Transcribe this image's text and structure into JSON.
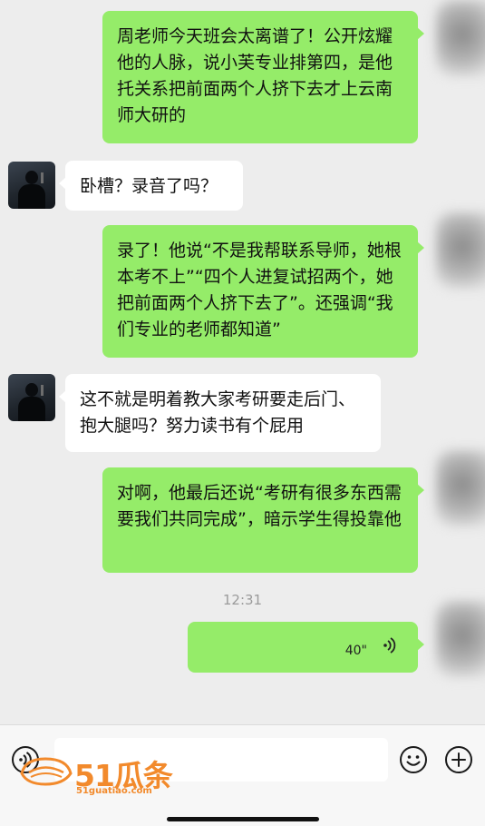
{
  "messages": [
    {
      "sender": "me",
      "text": "周老师今天班会太离谱了！公开炫耀他的人脉，说小芙专业排第四，是他托关系把前面两个人挤下去才上云南师大研的"
    },
    {
      "sender": "other",
      "text": "卧槽？录音了吗？"
    },
    {
      "sender": "me",
      "text": "录了！他说“不是我帮联系导师，她根本考不上”“四个人进复试招两个，她把前面两个人挤下去了”。还强调“我们专业的老师都知道”"
    },
    {
      "sender": "other",
      "text": "这不就是明着教大家考研要走后门、抱大腿吗？努力读书有个屁用"
    },
    {
      "sender": "me",
      "text": "对啊，他最后还说“考研有很多东西需要我们共同完成”，暗示学生得投靠他"
    }
  ],
  "timestamp": "12:31",
  "voice_message": {
    "duration": "40\""
  },
  "input_bar": {
    "voice_icon": "voice-input-icon",
    "emoji_icon": "emoji-icon",
    "plus_icon": "plus-icon"
  },
  "watermark": {
    "brand": "51瓜条",
    "url": "51guatiao.com"
  },
  "colors": {
    "my_bubble": "#95ec69",
    "other_bubble": "#ffffff",
    "background": "#ededed",
    "watermark": "#f28a2c"
  }
}
